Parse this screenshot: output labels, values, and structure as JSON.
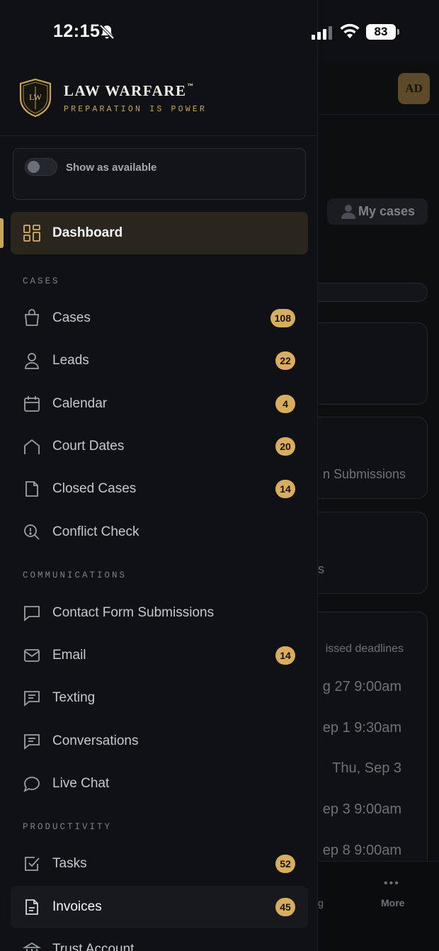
{
  "status_bar": {
    "time": "12:15",
    "battery": "83"
  },
  "brand": {
    "name": "LAW WARFARE",
    "trademark": "™",
    "tagline": "PREPARATION IS POWER",
    "logo_initials": "LW"
  },
  "availability": {
    "label": "Show as available",
    "on": false
  },
  "nav": {
    "dashboard": {
      "label": "Dashboard"
    },
    "sections": {
      "cases": "CASES",
      "communications": "COMMUNICATIONS",
      "productivity": "PRODUCTIVITY"
    },
    "cases": {
      "label": "Cases",
      "badge": "108"
    },
    "leads": {
      "label": "Leads",
      "badge": "22"
    },
    "calendar": {
      "label": "Calendar",
      "badge": "4"
    },
    "court_dates": {
      "label": "Court Dates",
      "badge": "20"
    },
    "closed_cases": {
      "label": "Closed Cases",
      "badge": "14"
    },
    "conflict_check": {
      "label": "Conflict Check"
    },
    "contact_forms": {
      "label": "Contact Form Submissions"
    },
    "email": {
      "label": "Email",
      "badge": "14"
    },
    "texting": {
      "label": "Texting"
    },
    "conversations": {
      "label": "Conversations"
    },
    "live_chat": {
      "label": "Live Chat"
    },
    "tasks": {
      "label": "Tasks",
      "badge": "52"
    },
    "invoices": {
      "label": "Invoices",
      "badge": "45"
    },
    "trust_account": {
      "label": "Trust Account"
    }
  },
  "background": {
    "avatar": "AD",
    "my_cases": "My cases",
    "card2_text": "n Submissions",
    "card3_text": "s",
    "deadlines_title": "issed deadlines",
    "deadlines": [
      "g 27 9:00am",
      "ep 1 9:30am",
      "Thu, Sep 3",
      "ep 3 9:00am",
      "ep 8 9:00am"
    ],
    "bottom_nav": {
      "more_label": "More",
      "partial_label": "g"
    }
  },
  "colors": {
    "accent": "#d9ad5f",
    "drawer_bg": "#0f1115",
    "active_bg": "#2a261d"
  }
}
